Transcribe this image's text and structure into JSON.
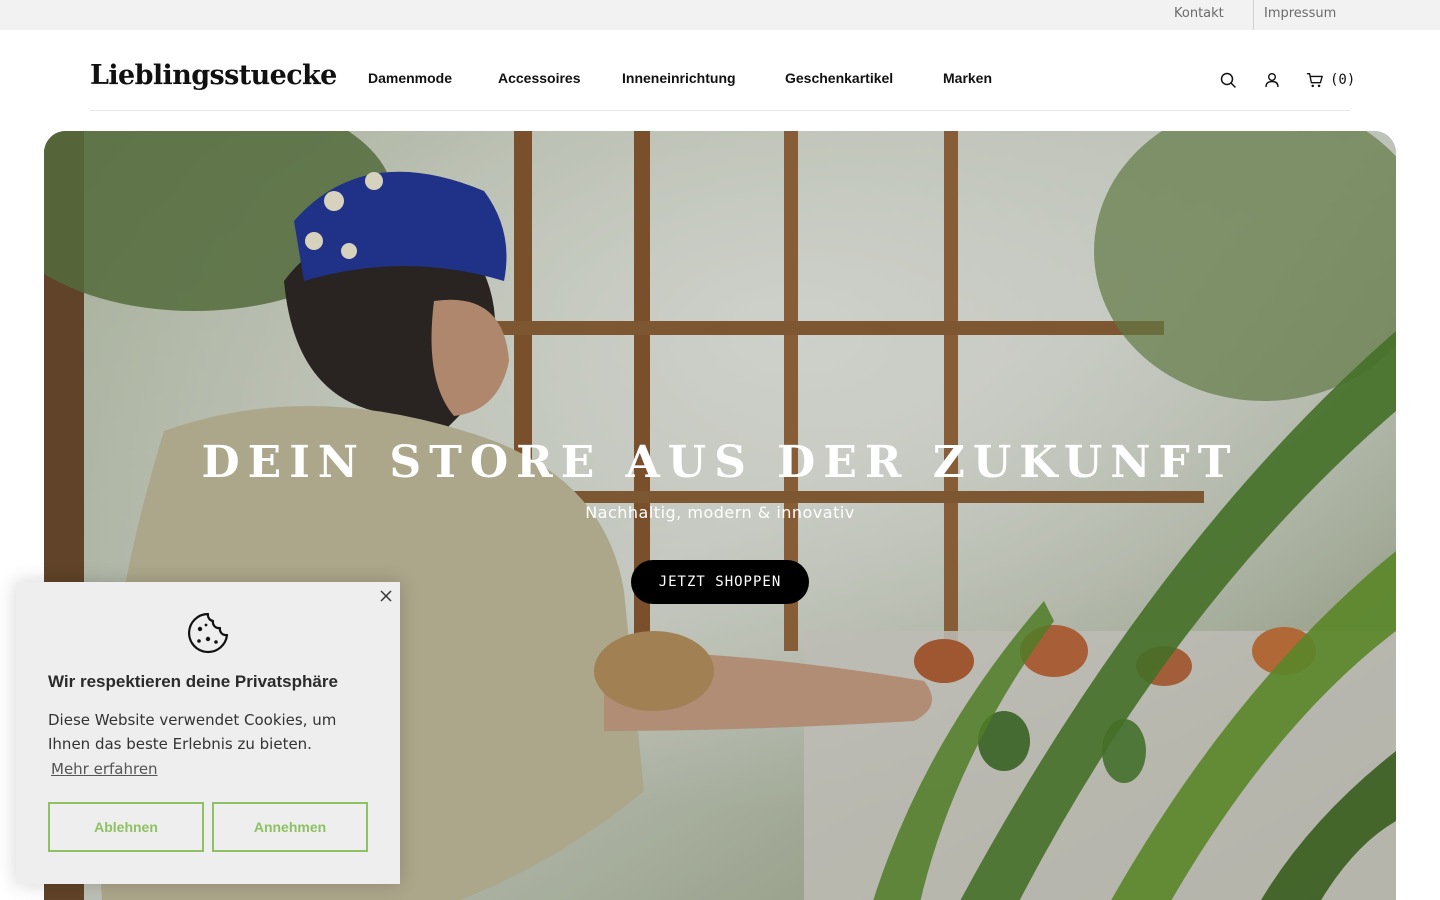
{
  "topbar": {
    "links": [
      "Kontakt",
      "Impressum"
    ]
  },
  "header": {
    "logo": "Lieblingsstuecke",
    "nav": [
      "Damenmode",
      "Accessoires",
      "Inneneinrichtung",
      "Geschenkartikel",
      "Marken"
    ],
    "icons": [
      "search-icon",
      "user-icon",
      "cart-icon"
    ],
    "cart_count": "(0)"
  },
  "hero": {
    "title": "DEIN STORE AUS DER ZUKUNFT",
    "subtitle": "Nachhaltig, modern & innovativ",
    "cta": "JETZT SHOPPEN"
  },
  "cookie": {
    "heading": "Wir respektieren deine Privatsphäre",
    "text": "Diese Website verwendet Cookies, um Ihnen das beste Erlebnis zu bieten.",
    "link": "Mehr erfahren",
    "decline": "Ablehnen",
    "accept": "Annehmen",
    "accent": "#8dc163"
  },
  "colors": {
    "topbar_bg": "#f2f2f2",
    "cta_bg": "#000000",
    "cookie_bg": "#eeeeee"
  }
}
